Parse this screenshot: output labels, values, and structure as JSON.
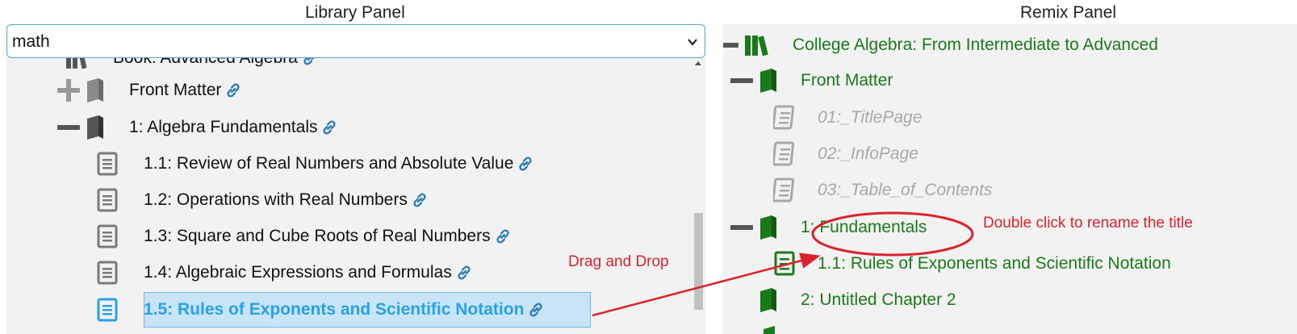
{
  "library": {
    "title": "Library Panel",
    "select_value": "math",
    "items": [
      {
        "label": "Book: Advanced Algebra"
      },
      {
        "label": "Front Matter"
      },
      {
        "label": "1: Algebra Fundamentals"
      },
      {
        "label": "1.1: Review of Real Numbers and Absolute Value"
      },
      {
        "label": "1.2: Operations with Real Numbers"
      },
      {
        "label": "1.3: Square and Cube Roots of Real Numbers"
      },
      {
        "label": "1.4: Algebraic Expressions and Formulas"
      },
      {
        "label": "1.5: Rules of Exponents and Scientific Notation"
      }
    ]
  },
  "remix": {
    "title": "Remix Panel",
    "items": [
      {
        "label": "College Algebra: From Intermediate to Advanced"
      },
      {
        "label": "Front Matter"
      },
      {
        "label": "01:_TitlePage"
      },
      {
        "label": "02:_InfoPage"
      },
      {
        "label": "03:_Table_of_Contents"
      },
      {
        "label": "1: Fundamentals"
      },
      {
        "label": "1.1: Rules of Exponents and Scientific Notation"
      },
      {
        "label": "2: Untitled Chapter 2"
      }
    ]
  },
  "annotations": {
    "drag_drop": "Drag and Drop",
    "rename": "Double click to rename the title"
  },
  "colors": {
    "annotation_red": "#d9232d",
    "remix_green": "#1a7a1a",
    "selection_blue": "#2aa0e8",
    "link_blue": "#2a7ab5"
  },
  "icons": {
    "book": "book-icon",
    "books": "books-icon",
    "page": "page-icon",
    "link": "link-icon",
    "expand": "plus-icon",
    "collapse": "minus-icon"
  }
}
